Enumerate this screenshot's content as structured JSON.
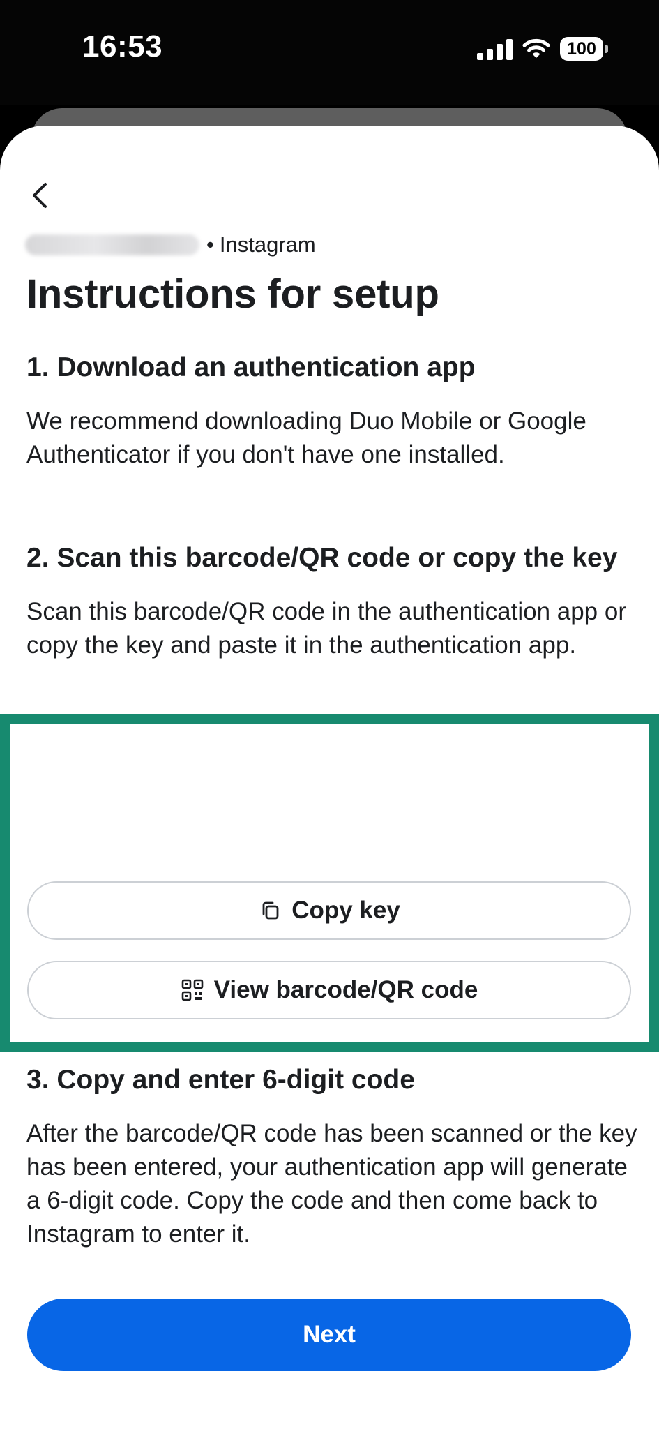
{
  "status_bar": {
    "time": "16:53",
    "battery": "100"
  },
  "header": {
    "app_name": "Instagram",
    "separator": "•",
    "title": "Instructions for setup"
  },
  "steps": [
    {
      "heading": "1. Download an authentication app",
      "body": "We recommend downloading Duo Mobile or Google Authenticator if you don't have one installed."
    },
    {
      "heading": "2. Scan this barcode/QR code or copy the key",
      "body": "Scan this barcode/QR code in the authentication app or copy the key and paste it in the authentication app."
    },
    {
      "heading": "3. Copy and enter 6-digit code",
      "body": "After the barcode/QR code has been scanned or the key has been entered, your authentication app will generate a 6-digit code. Copy the code and then come back to Instagram to enter it."
    }
  ],
  "actions": {
    "copy_key": "Copy key",
    "view_qr": "View barcode/QR code"
  },
  "footer": {
    "next": "Next"
  },
  "colors": {
    "primary_button": "#0866e6",
    "highlight_border": "#178a6f"
  },
  "icons": {
    "back": "chevron-left-icon",
    "copy": "copy-icon",
    "qr": "qr-code-icon"
  }
}
